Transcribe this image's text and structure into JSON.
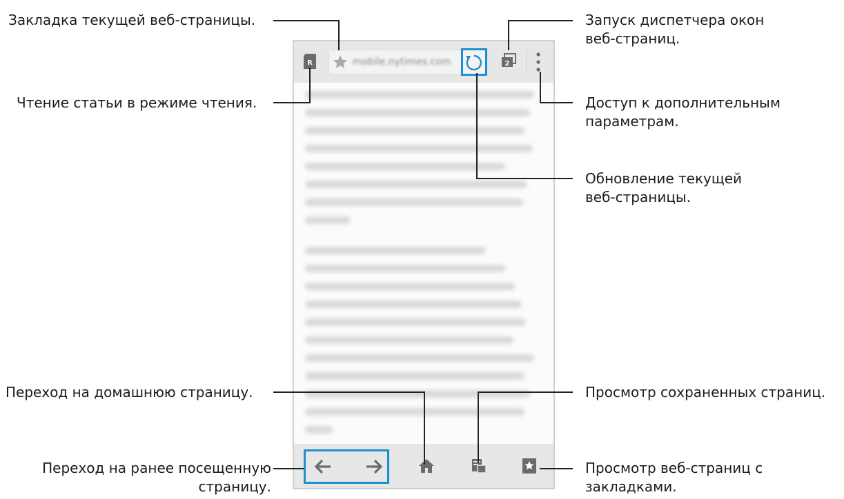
{
  "callouts": {
    "bookmark_current": "Закладка текущей веб-страницы.",
    "reader_mode": "Чтение статьи в режиме чтения.",
    "window_manager_line1": "Запуск диспетчера окон",
    "window_manager_line2": "веб-страниц.",
    "more_options_line1": "Доступ к дополнительным",
    "more_options_line2": "параметрам.",
    "refresh_line1": "Обновление текущей",
    "refresh_line2": "веб-страницы.",
    "home_page": "Переход на домашнюю страницу.",
    "saved_pages": "Просмотр сохраненных страниц.",
    "prev_page_line1": "Переход на ранее посещенную",
    "prev_page_line2": "страницу.",
    "bookmarks_line1": "Просмотр веб-страниц с",
    "bookmarks_line2": "закладками."
  },
  "browser": {
    "url": "mobile.nytimes.com",
    "reader_badge": "R",
    "tab_count": "2"
  },
  "colors": {
    "highlight": "#1e8fcf",
    "icon": "#6b6b6b"
  },
  "icons": [
    "reader-mode-icon",
    "star-icon",
    "refresh-icon",
    "window-manager-icon",
    "more-options-icon",
    "back-arrow-icon",
    "forward-arrow-icon",
    "home-icon",
    "saved-pages-icon",
    "bookmarks-icon"
  ]
}
